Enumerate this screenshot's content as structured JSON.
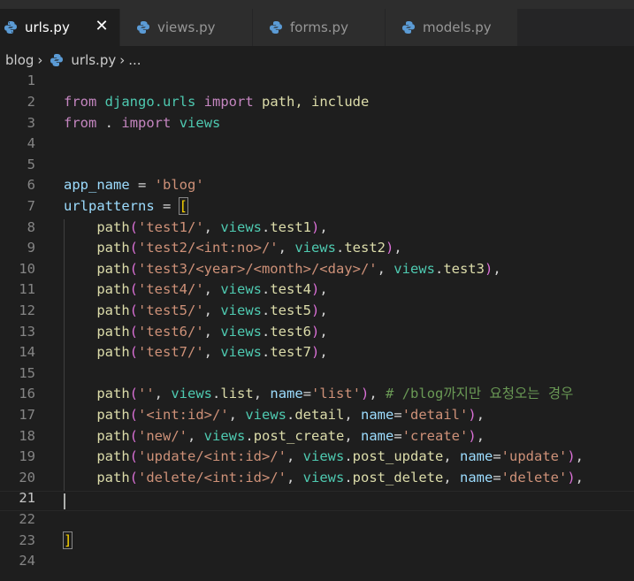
{
  "tabs": [
    {
      "label": "urls.py",
      "active": true,
      "close": "✕"
    },
    {
      "label": "views.py"
    },
    {
      "label": "forms.py"
    },
    {
      "label": "models.py"
    }
  ],
  "breadcrumb": {
    "folder": "blog",
    "file": "urls.py",
    "more": "..."
  },
  "lines": {
    "l2": {
      "kw1": "from",
      "mod": "django.urls",
      "kw2": "import",
      "rest": "path, include"
    },
    "l3": {
      "kw1": "from",
      "dot": ".",
      "kw2": "import",
      "mod": "views"
    },
    "l6": {
      "var": "app_name",
      "eq": " = ",
      "str": "'blog'"
    },
    "l7": {
      "var": "urlpatterns",
      "eq": " = ",
      "br": "["
    },
    "l8": {
      "fn": "path",
      "str": "'test1/'",
      "mod": "views",
      "attr": "test1"
    },
    "l9": {
      "fn": "path",
      "str": "'test2/<int:no>/'",
      "mod": "views",
      "attr": "test2"
    },
    "l10": {
      "fn": "path",
      "str": "'test3/<year>/<month>/<day>/'",
      "mod": "views",
      "attr": "test3"
    },
    "l11": {
      "fn": "path",
      "str": "'test4/'",
      "mod": "views",
      "attr": "test4"
    },
    "l12": {
      "fn": "path",
      "str": "'test5/'",
      "mod": "views",
      "attr": "test5"
    },
    "l13": {
      "fn": "path",
      "str": "'test6/'",
      "mod": "views",
      "attr": "test6"
    },
    "l14": {
      "fn": "path",
      "str": "'test7/'",
      "mod": "views",
      "attr": "test7"
    },
    "l16": {
      "fn": "path",
      "str": "''",
      "mod": "views",
      "attr": "list",
      "kwarg": "name",
      "kstr": "'list'",
      "comment": "# /blog까지만 요청오는 경우"
    },
    "l17": {
      "fn": "path",
      "str": "'<int:id>/'",
      "mod": "views",
      "attr": "detail",
      "kwarg": "name",
      "kstr": "'detail'"
    },
    "l18": {
      "fn": "path",
      "str": "'new/'",
      "mod": "views",
      "attr": "post_create",
      "kwarg": "name",
      "kstr": "'create'"
    },
    "l19": {
      "fn": "path",
      "str": "'update/<int:id>/'",
      "mod": "views",
      "attr": "post_update",
      "kwarg": "name",
      "kstr": "'update'"
    },
    "l20": {
      "fn": "path",
      "str": "'delete/<int:id>/'",
      "mod": "views",
      "attr": "post_delete",
      "kwarg": "name",
      "kstr": "'delete'"
    },
    "l23": {
      "br": "]"
    }
  },
  "line_numbers": [
    "1",
    "2",
    "3",
    "4",
    "5",
    "6",
    "7",
    "8",
    "9",
    "10",
    "11",
    "12",
    "13",
    "14",
    "15",
    "16",
    "17",
    "18",
    "19",
    "20",
    "21",
    "22",
    "23",
    "24"
  ],
  "colors": {
    "background": "#1e1e1e",
    "tab_active": "#1e1e1e",
    "tab_inactive": "#2d2d2d",
    "keyword": "#c586c0",
    "string": "#ce9178",
    "module": "#4ec9b0",
    "function": "#dcdcaa",
    "variable": "#9cdcfe",
    "comment": "#6a9955"
  },
  "icons": {
    "tab_file": "python-icon",
    "tab_close": "close-icon",
    "breadcrumb_separator": "chevron-right-icon"
  }
}
